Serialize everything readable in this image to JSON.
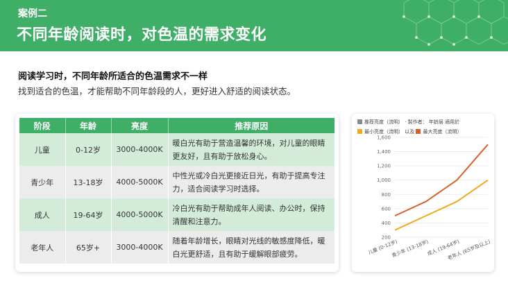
{
  "header": {
    "case_label": "案例二",
    "title": "不同年龄阅读时，对色温的需求变化"
  },
  "intro": {
    "subtitle": "阅读学习时，不同年龄所适合的色温需求不一样",
    "description": "找到适合的色温，才能帮助不同年龄段的人，更好进入舒适的阅读状态。"
  },
  "table": {
    "headers": [
      "阶段",
      "年龄",
      "亮度",
      "推荐原因"
    ],
    "rows": [
      {
        "stage": "儿童",
        "age": "0-12岁",
        "brightness": "3000-4000K",
        "reason": "暖白光有助于营造温馨的环境，对儿童的眼睛更友好，且有助于放松身心。"
      },
      {
        "stage": "青少年",
        "age": "13-18岁",
        "brightness": "4000-5000K",
        "reason": "中性光或冷白光更接近日光，有助于提高专注力，适合阅读学习时选择。"
      },
      {
        "stage": "成人",
        "age": "19-64岁",
        "brightness": "4000-5000K",
        "reason": "冷白光有助于帮助成年人阅读、办公时，保持清醒和注意力。"
      },
      {
        "stage": "老年人",
        "age": "65岁+",
        "brightness": "3000-4000K",
        "reason": "随着年龄增长，眼睛对光线的敏感度降低，暖白光更舒适，且有助于缓解眼部疲劳。"
      }
    ]
  },
  "chart_data": {
    "type": "line",
    "legend_line1": "推荐亮度（流明） · 製作者： 年龄层 適用於",
    "legend_line2_a": "最小亮度（流明）",
    "legend_line2_mid": "以及",
    "legend_line2_b": "最大亮度（流明）",
    "categories": [
      "儿童 (0-12岁)",
      "青少年 (13-18岁)",
      "成人 (19-64岁)",
      "老年人 (65岁及以上)"
    ],
    "series": [
      {
        "name": "最小亮度（流明）",
        "color": "#f2a81d",
        "values": [
          300,
          500,
          700,
          1000
        ]
      },
      {
        "name": "最大亮度（流明）",
        "color": "#d9602b",
        "values": [
          500,
          700,
          1000,
          1500
        ]
      }
    ],
    "yticks": [
      "200",
      "400",
      "600",
      "800",
      "1,000",
      "1,200",
      "1,400",
      "1,600"
    ],
    "ylim": [
      200,
      1600
    ]
  },
  "colors": {
    "brand_green": "#3fae67",
    "row_green": "#d3ecd9",
    "row_gray": "#ececec"
  }
}
